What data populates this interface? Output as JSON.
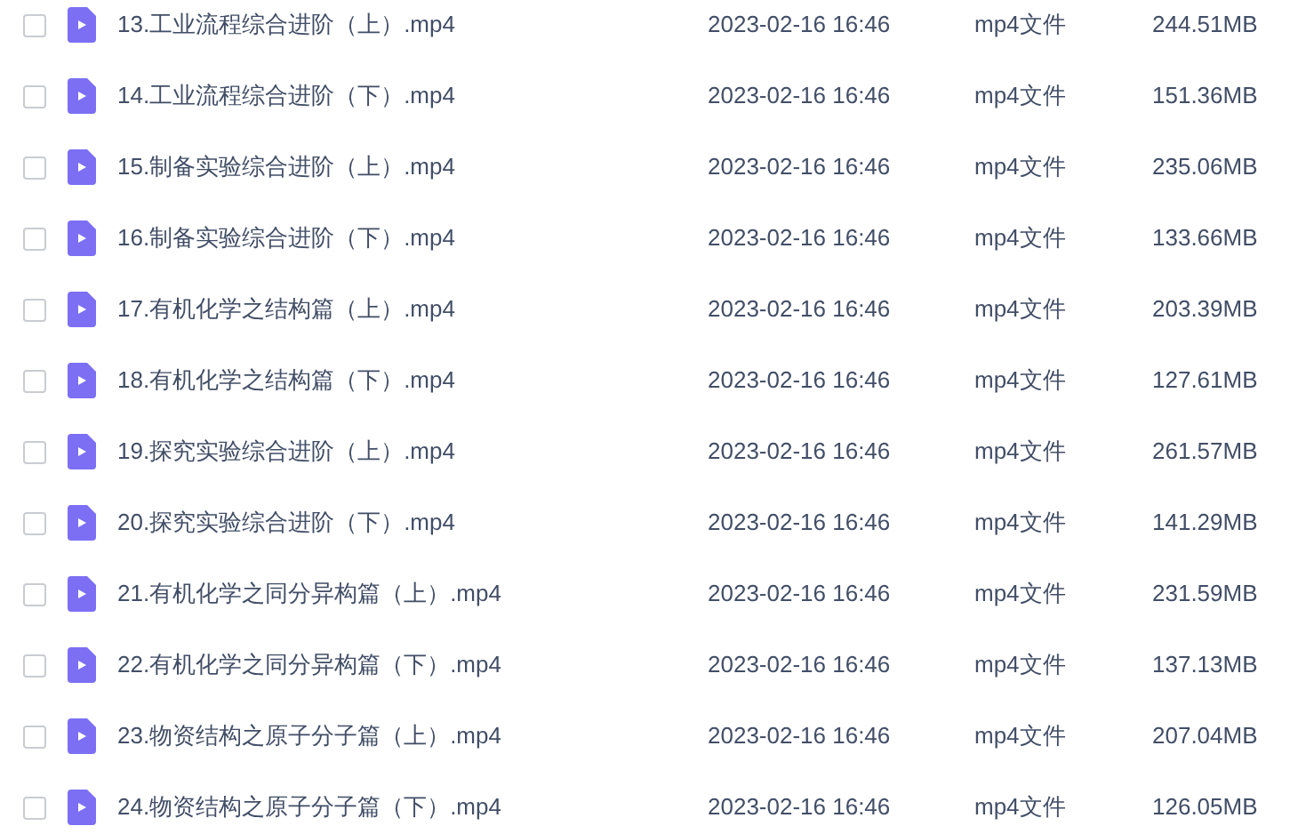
{
  "files": [
    {
      "name": "13.工业流程综合进阶（上）.mp4",
      "date": "2023-02-16 16:46",
      "type": "mp4文件",
      "size": "244.51MB",
      "checked": false
    },
    {
      "name": "14.工业流程综合进阶（下）.mp4",
      "date": "2023-02-16 16:46",
      "type": "mp4文件",
      "size": "151.36MB",
      "checked": false
    },
    {
      "name": "15.制备实验综合进阶（上）.mp4",
      "date": "2023-02-16 16:46",
      "type": "mp4文件",
      "size": "235.06MB",
      "checked": false
    },
    {
      "name": "16.制备实验综合进阶（下）.mp4",
      "date": "2023-02-16 16:46",
      "type": "mp4文件",
      "size": "133.66MB",
      "checked": false
    },
    {
      "name": "17.有机化学之结构篇（上）.mp4",
      "date": "2023-02-16 16:46",
      "type": "mp4文件",
      "size": "203.39MB",
      "checked": false
    },
    {
      "name": "18.有机化学之结构篇（下）.mp4",
      "date": "2023-02-16 16:46",
      "type": "mp4文件",
      "size": "127.61MB",
      "checked": false
    },
    {
      "name": "19.探究实验综合进阶（上）.mp4",
      "date": "2023-02-16 16:46",
      "type": "mp4文件",
      "size": "261.57MB",
      "checked": false
    },
    {
      "name": "20.探究实验综合进阶（下）.mp4",
      "date": "2023-02-16 16:46",
      "type": "mp4文件",
      "size": "141.29MB",
      "checked": false
    },
    {
      "name": "21.有机化学之同分异构篇（上）.mp4",
      "date": "2023-02-16 16:46",
      "type": "mp4文件",
      "size": "231.59MB",
      "checked": false
    },
    {
      "name": "22.有机化学之同分异构篇（下）.mp4",
      "date": "2023-02-16 16:46",
      "type": "mp4文件",
      "size": "137.13MB",
      "checked": false
    },
    {
      "name": "23.物资结构之原子分子篇（上）.mp4",
      "date": "2023-02-16 16:46",
      "type": "mp4文件",
      "size": "207.04MB",
      "checked": false
    },
    {
      "name": "24.物资结构之原子分子篇（下）.mp4",
      "date": "2023-02-16 16:46",
      "type": "mp4文件",
      "size": "126.05MB",
      "checked": false
    }
  ]
}
